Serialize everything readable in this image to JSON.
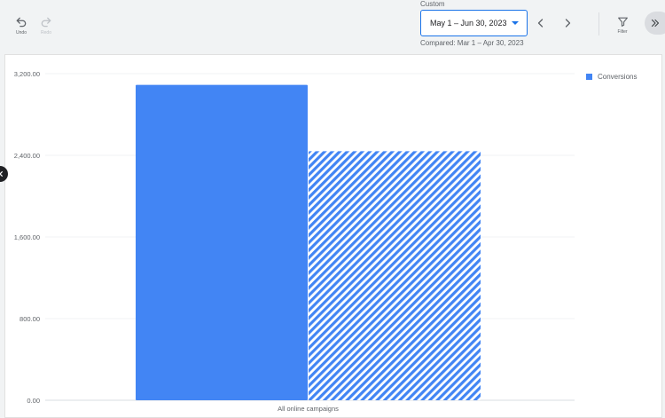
{
  "toolbar": {
    "undo_label": "Undo",
    "redo_label": "Redo",
    "filter_label": "Filter"
  },
  "date_range": {
    "label": "Custom",
    "value": "May 1 – Jun 30, 2023",
    "compare": "Compared: Mar 1 – Apr 30, 2023"
  },
  "colors": {
    "accent": "#1a73e8",
    "bar": "#4285f4"
  },
  "icons": [
    "undo-icon",
    "redo-icon",
    "chevron-left-icon",
    "chevron-right-icon",
    "filter-icon",
    "double-chevron-right-icon",
    "close-icon"
  ],
  "chart_data": {
    "type": "bar",
    "categories": [
      "All online campaigns"
    ],
    "series": [
      {
        "name": "Conversions",
        "values": [
          3090
        ]
      },
      {
        "values": [
          2440
        ],
        "pattern": "hatched"
      }
    ],
    "yticks": [
      "0.00",
      "800.00",
      "1,600.00",
      "2,400.00",
      "3,200.00"
    ],
    "ylim": [
      0,
      3200
    ],
    "grid": true,
    "legend_position": "top-right"
  }
}
